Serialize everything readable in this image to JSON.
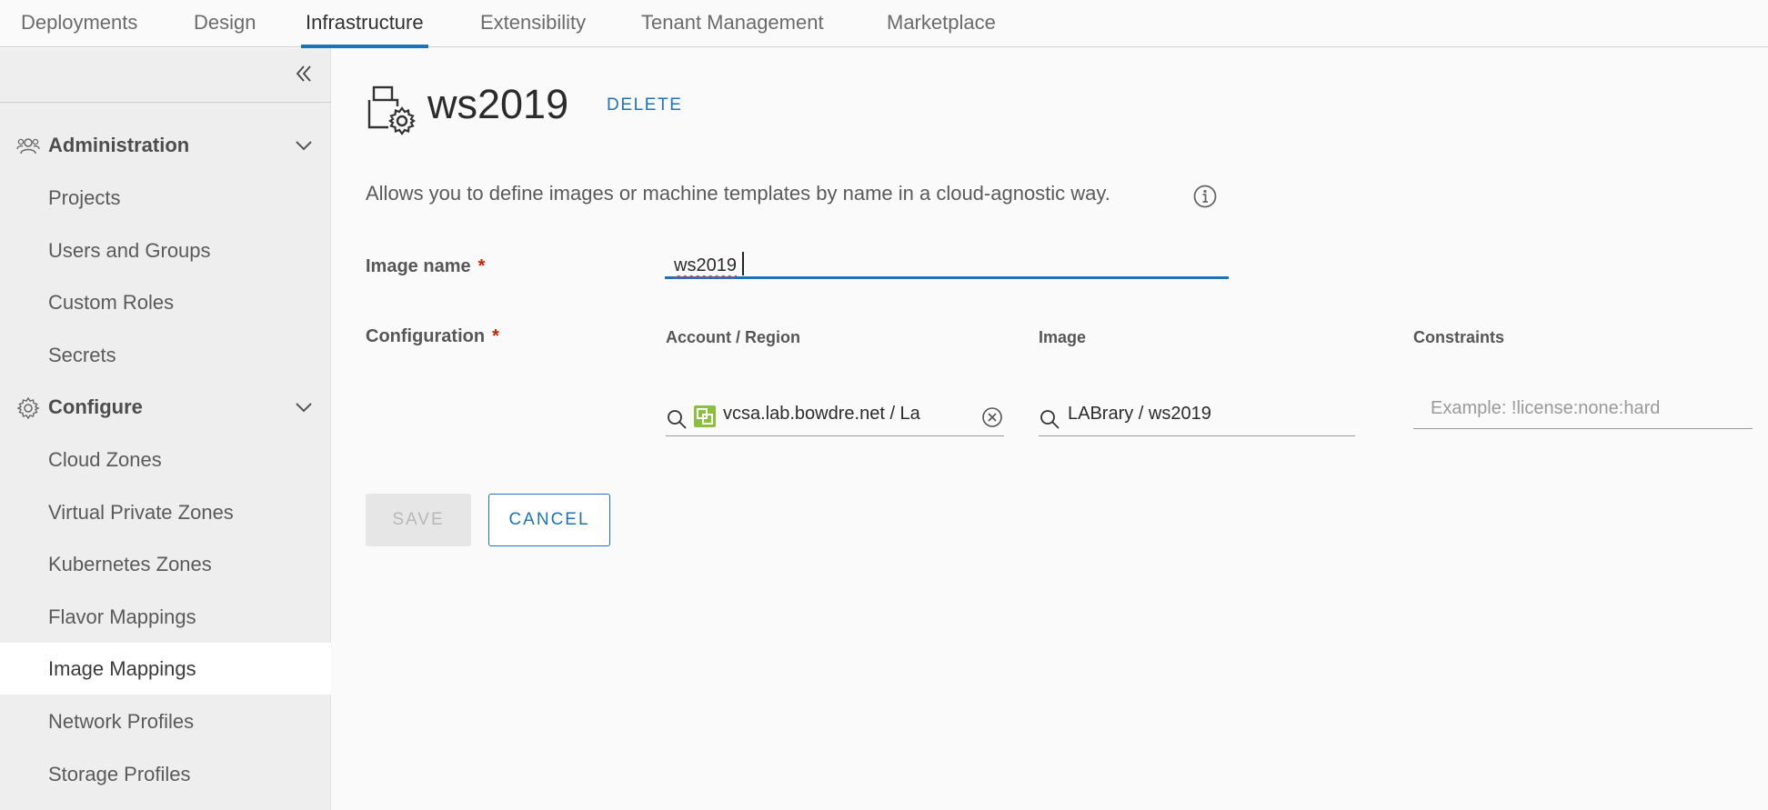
{
  "topnav": {
    "tabs": [
      "Deployments",
      "Design",
      "Infrastructure",
      "Extensibility",
      "Tenant Management",
      "Marketplace"
    ],
    "active": "Infrastructure"
  },
  "sidebar": {
    "administration": {
      "label": "Administration",
      "icon": "users-icon",
      "items": [
        "Projects",
        "Users and Groups",
        "Custom Roles",
        "Secrets"
      ]
    },
    "configure": {
      "label": "Configure",
      "icon": "gear-icon",
      "items": [
        "Cloud Zones",
        "Virtual Private Zones",
        "Kubernetes Zones",
        "Flavor Mappings",
        "Image Mappings",
        "Network Profiles",
        "Storage Profiles"
      ]
    },
    "active_item": "Image Mappings"
  },
  "page": {
    "title": "ws2019",
    "delete_label": "DELETE",
    "description": "Allows you to define images or machine templates by name in a cloud-agnostic way."
  },
  "form": {
    "image_name_label": "Image name",
    "image_name_value": "ws2019",
    "required_mark": "*",
    "configuration_label": "Configuration",
    "columns": {
      "account_region": "Account / Region",
      "image": "Image",
      "constraints": "Constraints"
    },
    "account_region_value": "vcsa.lab.bowdre.net / La",
    "image_value": "LABrary / ws2019",
    "constraints_placeholder": "Example: !license:none:hard"
  },
  "buttons": {
    "save": "SAVE",
    "cancel": "CANCEL"
  },
  "colors": {
    "accent": "#1f72b8",
    "required": "#c92100",
    "vsphere_green": "#8cbf3f"
  }
}
